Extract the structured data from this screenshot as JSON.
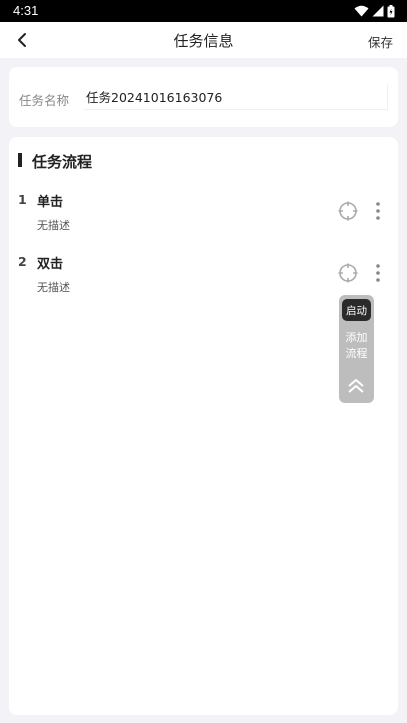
{
  "status_bar": {
    "time": "4:31"
  },
  "nav": {
    "title": "任务信息",
    "save_label": "保存"
  },
  "task": {
    "name_label": "任务名称",
    "name_value": "任务20241016163076"
  },
  "flow": {
    "title": "任务流程",
    "steps": [
      {
        "index": "1",
        "name": "单击",
        "description": "无描述"
      },
      {
        "index": "2",
        "name": "双击",
        "description": "无描述"
      }
    ]
  },
  "float_panel": {
    "start_label": "启动",
    "add_line1": "添加",
    "add_line2": "流程"
  }
}
